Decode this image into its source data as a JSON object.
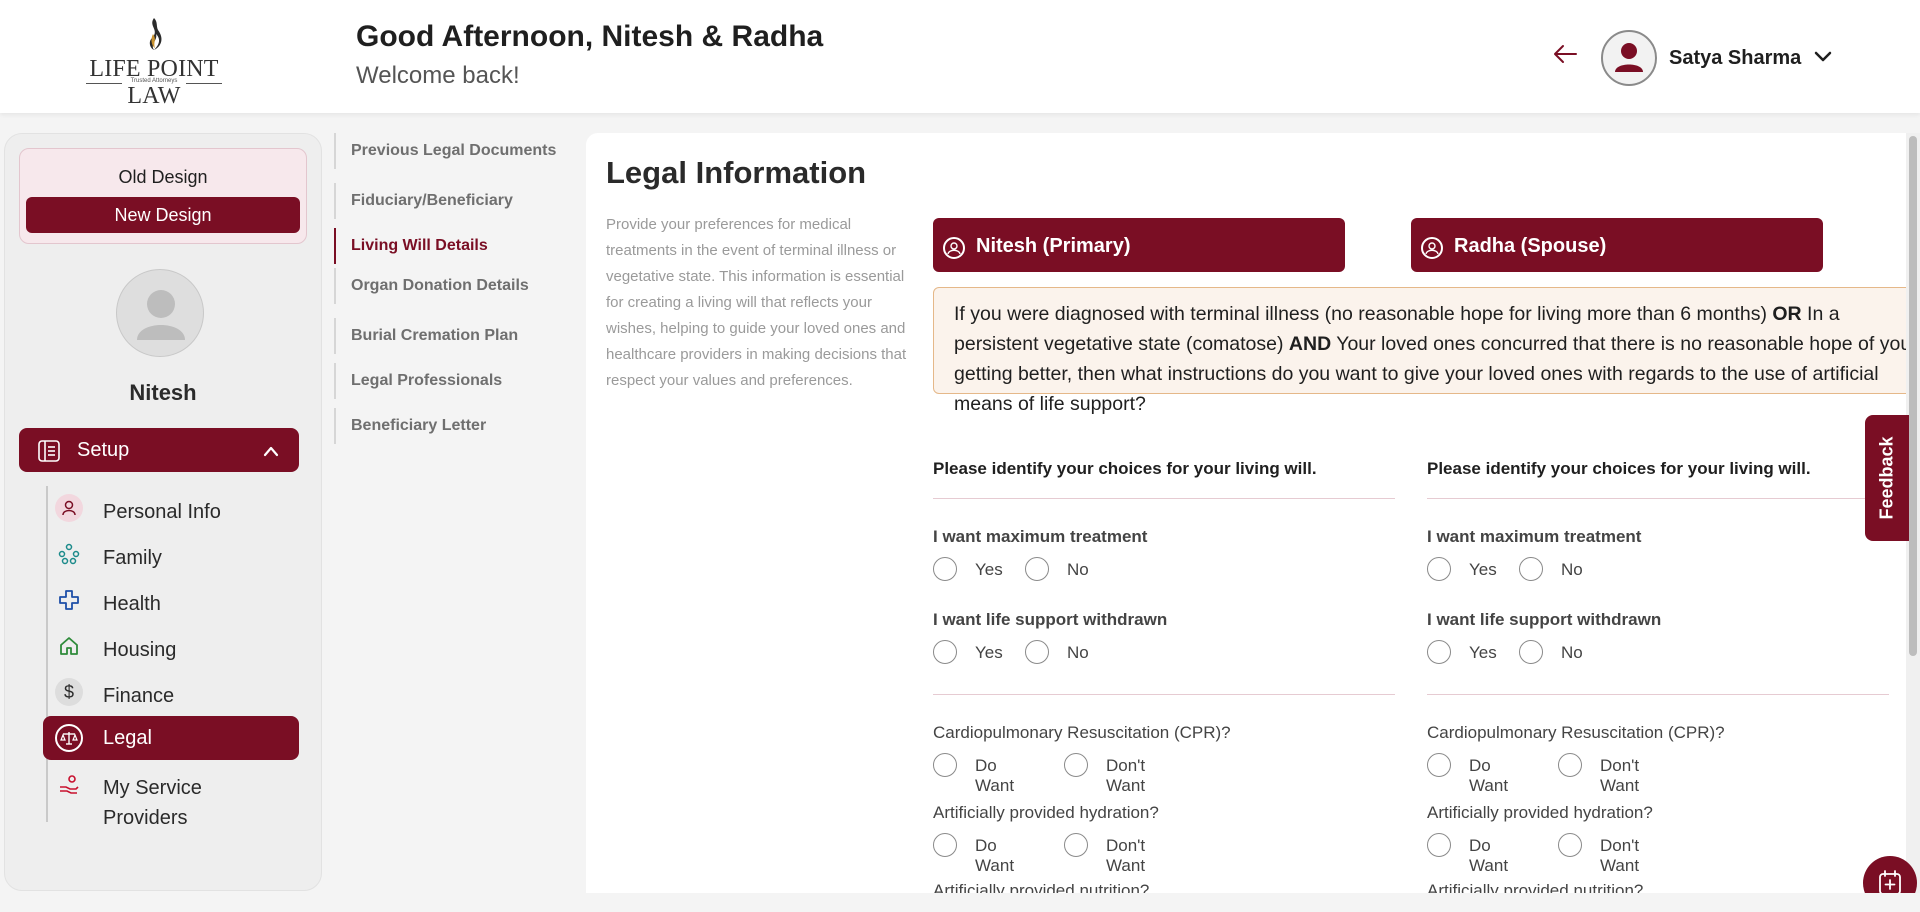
{
  "brand": {
    "name": "LIFE POINT LAW",
    "tagline": "Trusted Attorneys"
  },
  "header": {
    "greeting": "Good Afternoon, Nitesh & Radha",
    "subtitle": "Welcome back!",
    "user_name": "Satya Sharma"
  },
  "sidebar": {
    "old_design": "Old Design",
    "new_design": "New Design",
    "profile_name": "Nitesh",
    "setup_label": "Setup",
    "items": [
      {
        "label": "Personal Info",
        "icon": "person-icon"
      },
      {
        "label": "Family",
        "icon": "family-icon"
      },
      {
        "label": "Health",
        "icon": "health-cross-icon"
      },
      {
        "label": "Housing",
        "icon": "home-icon"
      },
      {
        "label": "Finance",
        "icon": "dollar-icon"
      },
      {
        "label": "Legal",
        "icon": "scales-icon",
        "active": true
      },
      {
        "label": "My Service Providers",
        "icon": "service-provider-icon"
      }
    ]
  },
  "subnav": {
    "items": [
      {
        "label": "Previous Legal Documents"
      },
      {
        "label": "Fiduciary/Beneficiary"
      },
      {
        "label": "Living Will Details",
        "active": true
      },
      {
        "label": "Organ Donation Details"
      },
      {
        "label": "Burial Cremation Plan"
      },
      {
        "label": "Legal Professionals"
      },
      {
        "label": "Beneficiary Letter"
      }
    ]
  },
  "main": {
    "title": "Legal Information",
    "description": "Provide your preferences for medical treatments in the event of terminal illness or vegetative state. This information is essential for creating a living will that reflects your wishes, helping to guide your loved ones and healthcare providers in making decisions that respect your values and preferences.",
    "persons": [
      "Nitesh (Primary)",
      "Radha (Spouse)"
    ],
    "notice": {
      "p1": "If you were diagnosed with terminal illness (no reasonable hope for living more than 6 months) ",
      "b1": "OR",
      "p2": " In a persistent vegetative state (comatose) ",
      "b2": "AND",
      "p3": " Your loved ones concurred that there is no reasonable hope of you getting better, then what instructions do you want to give your loved ones with regards to the use of artificial means of life support?"
    },
    "choices_heading": "Please identify your choices for your living will.",
    "q_max_treatment": "I want maximum treatment",
    "q_withdrawn": "I want life support withdrawn",
    "q_cpr": "Cardiopulmonary Resuscitation (CPR)?",
    "q_hydration": "Artificially provided hydration?",
    "q_nutrition": "Artificially provided nutrition?",
    "yes": "Yes",
    "no": "No",
    "do_want": "Do Want",
    "dont_want": "Don't Want"
  },
  "feedback_label": "Feedback",
  "colors": {
    "brand": "#7a0e24",
    "notice_bg": "#fbf3ec",
    "notice_border": "#e5b889"
  }
}
